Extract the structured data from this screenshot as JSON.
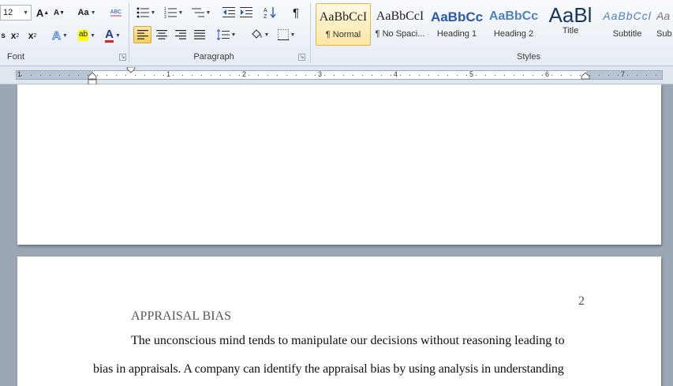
{
  "ribbon": {
    "font": {
      "font_size": "12",
      "grow_font": "A",
      "shrink_font": "A",
      "change_case": "Aa",
      "clear_format": "ABC",
      "subscript": "x",
      "superscript": "x",
      "text_effects": "A",
      "highlight": "ab",
      "font_color": "A",
      "group_label": "Font"
    },
    "paragraph": {
      "group_label": "Paragraph",
      "show_marks": "¶"
    },
    "styles": {
      "group_label": "Styles",
      "items": [
        {
          "sample": "AaBbCcI",
          "label": "¶ Normal"
        },
        {
          "sample": "AaBbCcI",
          "label": "¶ No Spaci..."
        },
        {
          "sample": "AaBbCc",
          "label": "Heading 1"
        },
        {
          "sample": "AaBbCc",
          "label": "Heading 2"
        },
        {
          "sample": "AaBl",
          "label": "Title"
        },
        {
          "sample": "AaBbCcl",
          "label": "Subtitle"
        },
        {
          "sample": "Aa",
          "label": "Sub"
        }
      ]
    }
  },
  "ruler": {
    "numbers": [
      "1",
      "1",
      "2",
      "3",
      "4",
      "5",
      "6",
      "7"
    ]
  },
  "document": {
    "page2": {
      "page_number": "2",
      "heading": "APPRAISAL BIAS",
      "line1": "The unconscious mind tends to manipulate our decisions without reasoning leading to",
      "line2": "bias in appraisals.  A company can identify the appraisal bias by using analysis in understanding"
    }
  },
  "colors": {
    "ribbon_bg": "#e6ecf4",
    "doc_bg": "#9ba7b5",
    "active_button": "#f9cf59",
    "heading_color": "#2b579a"
  }
}
